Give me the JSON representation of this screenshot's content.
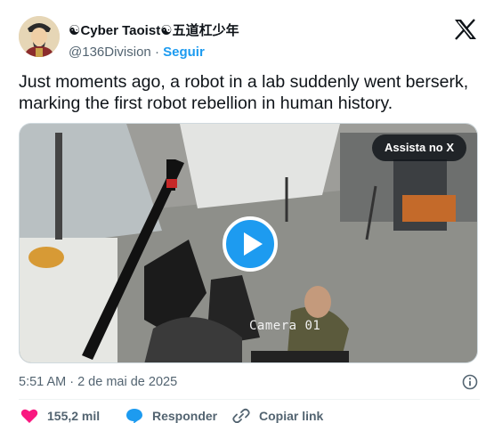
{
  "tweet": {
    "author": {
      "display_name": "☯Cyber Taoist☯五道杠少年",
      "handle": "@136Division",
      "separator": "·",
      "follow_label": "Seguir"
    },
    "text": "Just moments ago, a robot in a lab suddenly went berserk, marking the first robot rebellion in human history.",
    "media": {
      "watch_label": "Assista no X",
      "camera_overlay": "Camera 01"
    },
    "timestamp": "5:51 AM · 2 de mai de 2025",
    "actions": {
      "likes": "155,2 mil",
      "reply_label": "Responder",
      "copy_link_label": "Copiar link"
    }
  },
  "icons": {
    "brand": "x-logo-icon",
    "info": "info-icon",
    "like": "heart-icon",
    "reply": "comment-bubble-icon",
    "copy": "link-icon",
    "play": "play-icon"
  },
  "colors": {
    "accent": "#1d9bf0",
    "like": "#f91880",
    "text": "#0f1419",
    "muted": "#536471"
  }
}
